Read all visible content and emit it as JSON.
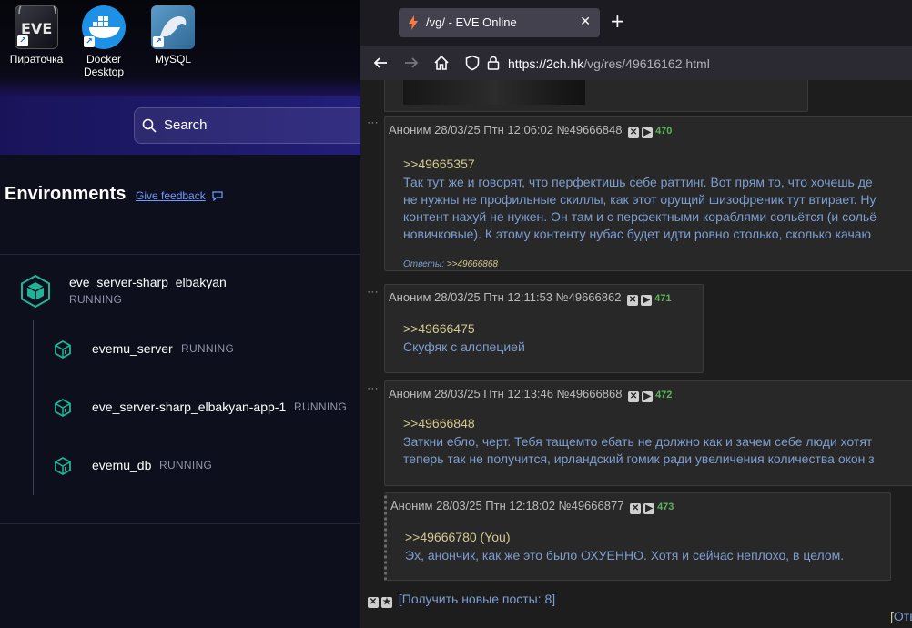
{
  "desktop": {
    "icons": [
      {
        "label": "Пираточка"
      },
      {
        "label_line1": "Docker",
        "label_line2": "Desktop"
      },
      {
        "label": "MySQL"
      }
    ]
  },
  "docker": {
    "search_label": "Search",
    "environments_title": "Environments",
    "feedback_link": "Give feedback",
    "containers": [
      {
        "name": "eve_server-sharp_elbakyan",
        "status": "RUNNING"
      },
      {
        "name": "evemu_server",
        "status": "RUNNING"
      },
      {
        "name": "eve_server-sharp_elbakyan-app-1",
        "status": "RUNNING"
      },
      {
        "name": "evemu_db",
        "status": "RUNNING"
      }
    ],
    "accent_color": "#1fb39a"
  },
  "browser": {
    "tab_title": "/vg/ - EVE Online",
    "tab_close": "✕",
    "new_tab": "+",
    "url_host": "https://2ch.hk",
    "url_path": "/vg/res/49616162.html"
  },
  "thread": {
    "posts": [
      {
        "author": "Аноним",
        "date": "28/03/25 Птн 12:06:02",
        "id": "№49666848",
        "count": "470",
        "reply_to": ">>49665357",
        "lines": [
          "Так тут же и говорят, что перфектишь себе раттинг. Вот прям то, что хочешь де",
          "не нужны не профильные скиллы, как этот орущий шизофреник тут втирает. Ну",
          "контент нахуй не нужен. Он там и с перфектными кораблями сольётся (и сольё",
          "новичковые). К этому контенту нубас будет идти ровно столько, сколько качаю"
        ],
        "answers_label": "Ответы:",
        "answers_link": ">>49666868"
      },
      {
        "author": "Аноним",
        "date": "28/03/25 Птн 12:11:53",
        "id": "№49666862",
        "count": "471",
        "reply_to": ">>49666475",
        "lines": [
          "Скуфяк с алопецией"
        ]
      },
      {
        "author": "Аноним",
        "date": "28/03/25 Птн 12:13:46",
        "id": "№49666868",
        "count": "472",
        "reply_to": ">>49666848",
        "lines": [
          "Заткни ебло, черт. Тебя тащемто ебать не должно как и зачем себе люди хотят",
          "теперь так не получится, ирландский гомик ради увеличения количества окон з"
        ]
      },
      {
        "author": "Аноним",
        "date": "28/03/25 Птн 12:18:02",
        "id": "№49666877",
        "count": "473",
        "reply_to": ">>49666780 (You)",
        "lines": [
          "Эх, анончик, как же это было ОХУЕННО. Хотя и сейчас неплохо, в целом."
        ]
      }
    ],
    "new_posts_label": "[Получить новые посты: 8]",
    "corner_bracket": "[",
    "corner_word": "Отв"
  }
}
